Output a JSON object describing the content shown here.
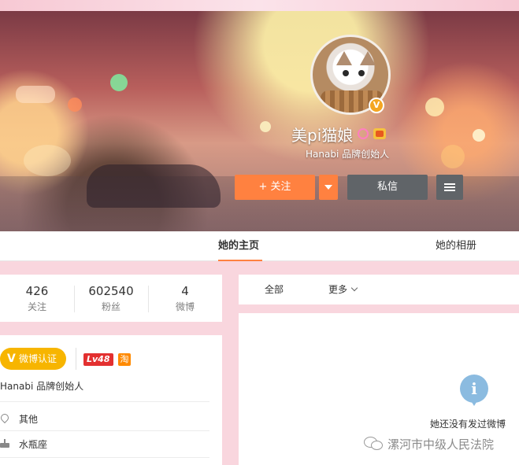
{
  "profile": {
    "name": "美pi猫娘",
    "subtitle": "Hanabi 品牌创始人",
    "avatar_badge": "V"
  },
  "actions": {
    "follow_label": "+ 关注",
    "message_label": "私信"
  },
  "tabs": [
    {
      "label": "她的主页",
      "active": true
    },
    {
      "label": "她的相册",
      "active": false
    }
  ],
  "stats": [
    {
      "value": "426",
      "label": "关注"
    },
    {
      "value": "602540",
      "label": "粉丝"
    },
    {
      "value": "4",
      "label": "微博"
    }
  ],
  "info": {
    "verify_label": "微博认证",
    "verify_v": "V",
    "level": "Lv48",
    "taobao_glyph": "淘",
    "description": "Hanabi 品牌创始人",
    "location": "其他",
    "zodiac": "水瓶座"
  },
  "filter": {
    "all_label": "全部",
    "more_label": "更多"
  },
  "feed": {
    "info_glyph": "i",
    "empty_text": "她还没有发过微博"
  },
  "watermark": {
    "text": "漯河市中级人民法院"
  },
  "colors": {
    "accent": "#ff8140",
    "dark_button": "#606468",
    "verify": "#f7b500",
    "page_bg": "#f9d6de"
  }
}
